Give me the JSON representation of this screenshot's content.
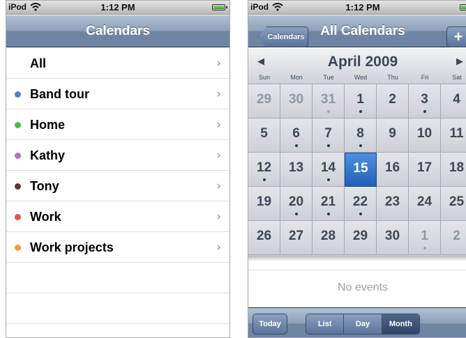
{
  "status": {
    "carrier": "iPod",
    "time": "1:12 PM"
  },
  "left": {
    "title": "Calendars",
    "rows": [
      {
        "label": "All",
        "color": null
      },
      {
        "label": "Band tour",
        "color": "#5a7ec8"
      },
      {
        "label": "Home",
        "color": "#4fba4a"
      },
      {
        "label": "Kathy",
        "color": "#b86fc2"
      },
      {
        "label": "Tony",
        "color": "#5b3a36"
      },
      {
        "label": "Work",
        "color": "#e4524f"
      },
      {
        "label": "Work projects",
        "color": "#f09a47"
      }
    ]
  },
  "right": {
    "back_label": "Calendars",
    "title": "All Calendars",
    "add_label": "+",
    "month": "April 2009",
    "prev_arrow": "◀",
    "next_arrow": "▶",
    "weekdays": [
      "Sun",
      "Mon",
      "Tue",
      "Wed",
      "Thu",
      "Fri",
      "Sat"
    ],
    "days": [
      {
        "n": "29",
        "out": true,
        "dot": false
      },
      {
        "n": "30",
        "out": true,
        "dot": false
      },
      {
        "n": "31",
        "out": true,
        "dot": true
      },
      {
        "n": "1",
        "out": false,
        "dot": true
      },
      {
        "n": "2",
        "out": false,
        "dot": false
      },
      {
        "n": "3",
        "out": false,
        "dot": true
      },
      {
        "n": "4",
        "out": false,
        "dot": false
      },
      {
        "n": "5",
        "out": false,
        "dot": false
      },
      {
        "n": "6",
        "out": false,
        "dot": true
      },
      {
        "n": "7",
        "out": false,
        "dot": true
      },
      {
        "n": "8",
        "out": false,
        "dot": true
      },
      {
        "n": "9",
        "out": false,
        "dot": false
      },
      {
        "n": "10",
        "out": false,
        "dot": false
      },
      {
        "n": "11",
        "out": false,
        "dot": false
      },
      {
        "n": "12",
        "out": false,
        "dot": true
      },
      {
        "n": "13",
        "out": false,
        "dot": false
      },
      {
        "n": "14",
        "out": false,
        "dot": true
      },
      {
        "n": "15",
        "out": false,
        "dot": false,
        "today": true
      },
      {
        "n": "16",
        "out": false,
        "dot": false
      },
      {
        "n": "17",
        "out": false,
        "dot": false
      },
      {
        "n": "18",
        "out": false,
        "dot": false
      },
      {
        "n": "19",
        "out": false,
        "dot": false
      },
      {
        "n": "20",
        "out": false,
        "dot": true
      },
      {
        "n": "21",
        "out": false,
        "dot": true
      },
      {
        "n": "22",
        "out": false,
        "dot": true
      },
      {
        "n": "23",
        "out": false,
        "dot": false
      },
      {
        "n": "24",
        "out": false,
        "dot": false
      },
      {
        "n": "25",
        "out": false,
        "dot": false
      },
      {
        "n": "26",
        "out": false,
        "dot": false
      },
      {
        "n": "27",
        "out": false,
        "dot": false
      },
      {
        "n": "28",
        "out": false,
        "dot": false
      },
      {
        "n": "29",
        "out": false,
        "dot": false
      },
      {
        "n": "30",
        "out": false,
        "dot": false
      },
      {
        "n": "1",
        "out": true,
        "dot": true
      },
      {
        "n": "2",
        "out": true,
        "dot": false
      }
    ],
    "no_events": "No events",
    "toolbar": {
      "today": "Today",
      "segments": [
        "List",
        "Day",
        "Month"
      ],
      "active": "Month"
    }
  }
}
